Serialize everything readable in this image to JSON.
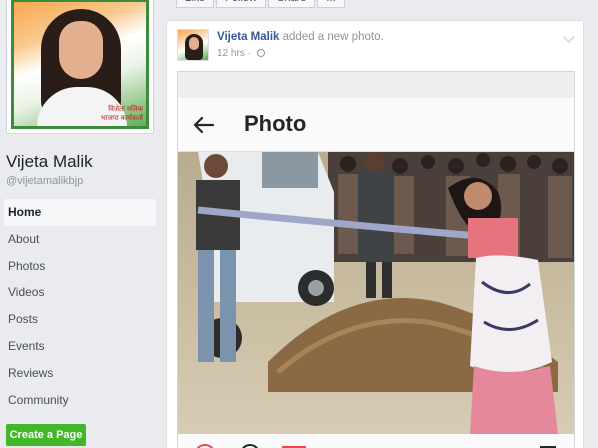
{
  "page": {
    "name": "Vijeta Malik",
    "handle": "@vijetamalikbjp",
    "profile_caption": "विजेता मलिक\nभाजपा कार्यकर्ता"
  },
  "nav": {
    "items": [
      {
        "label": "Home",
        "active": true
      },
      {
        "label": "About"
      },
      {
        "label": "Photos"
      },
      {
        "label": "Videos"
      },
      {
        "label": "Posts"
      },
      {
        "label": "Events"
      },
      {
        "label": "Reviews"
      },
      {
        "label": "Community"
      }
    ]
  },
  "create_page_label": "Create a Page",
  "top_actions": {
    "like": "Like",
    "follow": "Follow",
    "share": "Share",
    "more": "..."
  },
  "post": {
    "author": "Vijeta Malik",
    "action_text": " added a new photo.",
    "time": "12 hrs",
    "embed_title": "Photo"
  },
  "colors": {
    "link": "#365899",
    "create_button": "#42b72a",
    "background": "#e9ebee"
  },
  "icons": {
    "back": "back-arrow-icon",
    "globe": "globe-icon",
    "chevron": "chevron-down-icon"
  }
}
